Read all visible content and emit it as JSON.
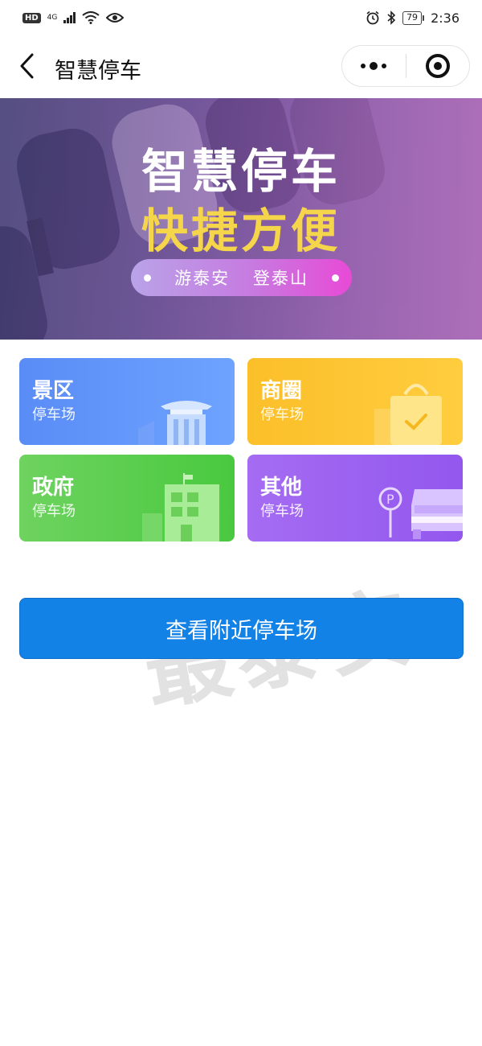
{
  "status_bar": {
    "hd_badge": "HD",
    "network": "4G",
    "battery": "79",
    "time": "2:36",
    "icons": [
      "signal-icon",
      "wifi-icon",
      "eye-icon",
      "alarm-icon",
      "bluetooth-icon",
      "battery-icon"
    ]
  },
  "nav": {
    "title": "智慧停车",
    "back_icon": "chevron-left-icon",
    "more_icon": "more-dots-icon",
    "close_icon": "target-circle-icon"
  },
  "banner": {
    "line1": "智慧停车",
    "line2": "快捷方便",
    "slogan": "游泰安 登泰山",
    "colors": {
      "line2": "#f5d54a",
      "base": "#7d58a8"
    }
  },
  "categories": [
    {
      "name": "景区",
      "sub": "停车场",
      "icon": "temple-icon",
      "color": "#5a8cf6"
    },
    {
      "name": "商圈",
      "sub": "停车场",
      "icon": "shopping-bag-icon",
      "color": "#fbbf29"
    },
    {
      "name": "政府",
      "sub": "停车场",
      "icon": "office-building-icon",
      "color": "#49c93f"
    },
    {
      "name": "其他",
      "sub": "停车场",
      "icon": "parking-car-icon",
      "color": "#9357ee"
    }
  ],
  "main_button": {
    "label": "查看附近停车场",
    "color": "#1282e6"
  },
  "watermark": "最泰安"
}
